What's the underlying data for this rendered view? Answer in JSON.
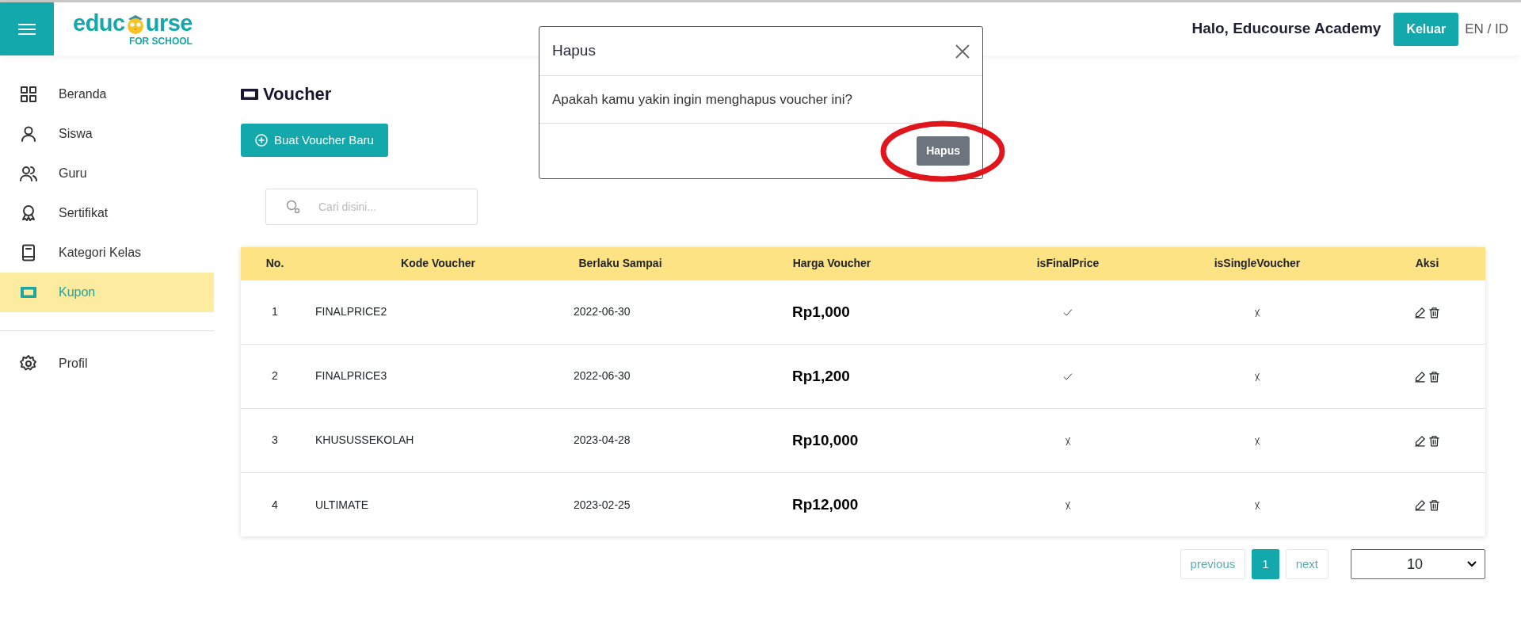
{
  "header": {
    "logo": {
      "word_start": "educ",
      "word_end": "urse",
      "tagline": "FOR SCHOOL"
    },
    "greeting": "Halo, Educourse Academy",
    "logout_button": "Keluar",
    "language": "EN / ID"
  },
  "sidebar": {
    "groups": [
      [
        {
          "label": "Beranda",
          "selected": false
        },
        {
          "label": "Siswa",
          "selected": false
        },
        {
          "label": "Guru",
          "selected": false
        },
        {
          "label": "Sertifikat",
          "selected": false
        },
        {
          "label": "Kategori Kelas",
          "selected": false
        },
        {
          "label": "Kupon",
          "selected": true
        }
      ],
      [
        {
          "label": "Profil",
          "selected": false
        }
      ]
    ]
  },
  "page": {
    "title": "Voucher",
    "create_button": "Buat Voucher Baru",
    "search": {
      "placeholder": "Cari disini..."
    }
  },
  "table": {
    "columns": [
      "No.",
      "Kode Voucher",
      "Berlaku Sampai",
      "Harga Voucher",
      "isFinalPrice",
      "isSingleVoucher",
      "Aksi"
    ],
    "rows": [
      {
        "no": "1",
        "code": "FINALPRICE2",
        "valid_until": "2022-06-30",
        "price": "Rp1,000",
        "final_price": true,
        "single_voucher": false
      },
      {
        "no": "2",
        "code": "FINALPRICE3",
        "valid_until": "2022-06-30",
        "price": "Rp1,200",
        "final_price": true,
        "single_voucher": false
      },
      {
        "no": "3",
        "code": "KHUSUSSEKOLAH",
        "valid_until": "2023-04-28",
        "price": "Rp10,000",
        "final_price": false,
        "single_voucher": false
      },
      {
        "no": "4",
        "code": "ULTIMATE",
        "valid_until": "2023-02-25",
        "price": "Rp12,000",
        "final_price": false,
        "single_voucher": false
      }
    ]
  },
  "pagination": {
    "previous": "previous",
    "pages": [
      {
        "label": "1",
        "selected": true
      }
    ],
    "next": "next",
    "page_size": "10"
  },
  "modal": {
    "title": "Hapus",
    "message": "Apakah kamu yakin ingin menghapus voucher ini?",
    "confirm_button": "Hapus"
  }
}
